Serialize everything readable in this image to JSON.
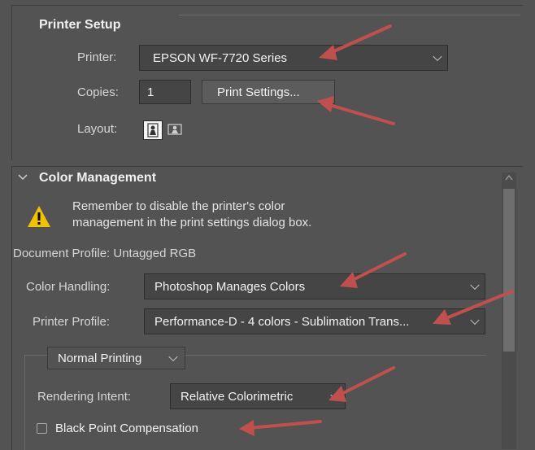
{
  "printer_setup": {
    "title": "Printer Setup",
    "printer_label": "Printer:",
    "printer_value": "EPSON WF-7720 Series",
    "copies_label": "Copies:",
    "copies_value": "1",
    "print_settings_button": "Print Settings...",
    "layout_label": "Layout:",
    "layout_icons": [
      "portrait-layout-icon",
      "landscape-layout-icon"
    ]
  },
  "color_management": {
    "title": "Color Management",
    "warning_line1": "Remember to disable the printer's color",
    "warning_line2": "management in the print settings dialog box.",
    "document_profile": "Document Profile: Untagged RGB",
    "color_handling_label": "Color Handling:",
    "color_handling_value": "Photoshop Manages Colors",
    "printer_profile_label": "Printer Profile:",
    "printer_profile_value": "Performance-D - 4 colors - Sublimation Trans...",
    "normal_printing": "Normal Printing",
    "rendering_intent_label": "Rendering Intent:",
    "rendering_intent_value": "Relative Colorimetric",
    "black_point_label": "Black Point Compensation",
    "black_point_checked": false
  },
  "colors": {
    "annotation_arrow": "#c0504d",
    "warning_triangle": "#f2c200"
  }
}
